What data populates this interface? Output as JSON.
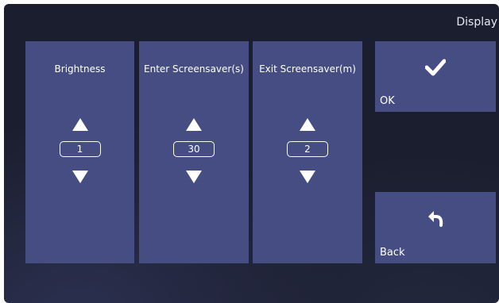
{
  "header": {
    "title": "Display"
  },
  "panels": [
    {
      "label": "Brightness",
      "value": "1"
    },
    {
      "label": "Enter Screensaver(s)",
      "value": "30"
    },
    {
      "label": "Exit Screensaver(m)",
      "value": "2"
    }
  ],
  "buttons": {
    "ok_label": "OK",
    "ok_icon": "checkmark-icon",
    "back_label": "Back",
    "back_icon": "back-arrow-icon"
  },
  "colors": {
    "background": "#1b1e2e",
    "panel": "#454d82",
    "text": "#ffffff"
  }
}
